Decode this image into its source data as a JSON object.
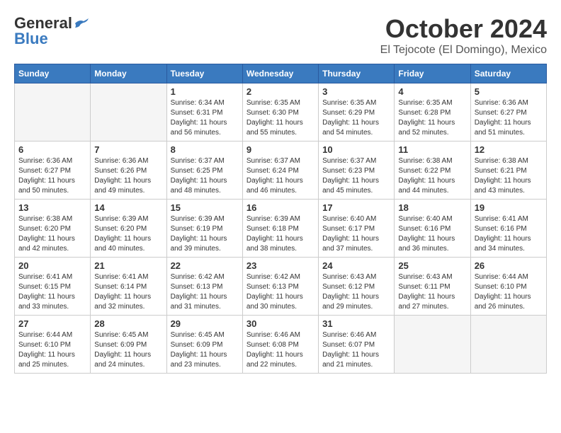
{
  "header": {
    "logo_line1": "General",
    "logo_line2": "Blue",
    "month": "October 2024",
    "location": "El Tejocote (El Domingo), Mexico"
  },
  "days_of_week": [
    "Sunday",
    "Monday",
    "Tuesday",
    "Wednesday",
    "Thursday",
    "Friday",
    "Saturday"
  ],
  "weeks": [
    [
      {
        "day": "",
        "info": ""
      },
      {
        "day": "",
        "info": ""
      },
      {
        "day": "1",
        "info": "Sunrise: 6:34 AM\nSunset: 6:31 PM\nDaylight: 11 hours and 56 minutes."
      },
      {
        "day": "2",
        "info": "Sunrise: 6:35 AM\nSunset: 6:30 PM\nDaylight: 11 hours and 55 minutes."
      },
      {
        "day": "3",
        "info": "Sunrise: 6:35 AM\nSunset: 6:29 PM\nDaylight: 11 hours and 54 minutes."
      },
      {
        "day": "4",
        "info": "Sunrise: 6:35 AM\nSunset: 6:28 PM\nDaylight: 11 hours and 52 minutes."
      },
      {
        "day": "5",
        "info": "Sunrise: 6:36 AM\nSunset: 6:27 PM\nDaylight: 11 hours and 51 minutes."
      }
    ],
    [
      {
        "day": "6",
        "info": "Sunrise: 6:36 AM\nSunset: 6:27 PM\nDaylight: 11 hours and 50 minutes."
      },
      {
        "day": "7",
        "info": "Sunrise: 6:36 AM\nSunset: 6:26 PM\nDaylight: 11 hours and 49 minutes."
      },
      {
        "day": "8",
        "info": "Sunrise: 6:37 AM\nSunset: 6:25 PM\nDaylight: 11 hours and 48 minutes."
      },
      {
        "day": "9",
        "info": "Sunrise: 6:37 AM\nSunset: 6:24 PM\nDaylight: 11 hours and 46 minutes."
      },
      {
        "day": "10",
        "info": "Sunrise: 6:37 AM\nSunset: 6:23 PM\nDaylight: 11 hours and 45 minutes."
      },
      {
        "day": "11",
        "info": "Sunrise: 6:38 AM\nSunset: 6:22 PM\nDaylight: 11 hours and 44 minutes."
      },
      {
        "day": "12",
        "info": "Sunrise: 6:38 AM\nSunset: 6:21 PM\nDaylight: 11 hours and 43 minutes."
      }
    ],
    [
      {
        "day": "13",
        "info": "Sunrise: 6:38 AM\nSunset: 6:20 PM\nDaylight: 11 hours and 42 minutes."
      },
      {
        "day": "14",
        "info": "Sunrise: 6:39 AM\nSunset: 6:20 PM\nDaylight: 11 hours and 40 minutes."
      },
      {
        "day": "15",
        "info": "Sunrise: 6:39 AM\nSunset: 6:19 PM\nDaylight: 11 hours and 39 minutes."
      },
      {
        "day": "16",
        "info": "Sunrise: 6:39 AM\nSunset: 6:18 PM\nDaylight: 11 hours and 38 minutes."
      },
      {
        "day": "17",
        "info": "Sunrise: 6:40 AM\nSunset: 6:17 PM\nDaylight: 11 hours and 37 minutes."
      },
      {
        "day": "18",
        "info": "Sunrise: 6:40 AM\nSunset: 6:16 PM\nDaylight: 11 hours and 36 minutes."
      },
      {
        "day": "19",
        "info": "Sunrise: 6:41 AM\nSunset: 6:16 PM\nDaylight: 11 hours and 34 minutes."
      }
    ],
    [
      {
        "day": "20",
        "info": "Sunrise: 6:41 AM\nSunset: 6:15 PM\nDaylight: 11 hours and 33 minutes."
      },
      {
        "day": "21",
        "info": "Sunrise: 6:41 AM\nSunset: 6:14 PM\nDaylight: 11 hours and 32 minutes."
      },
      {
        "day": "22",
        "info": "Sunrise: 6:42 AM\nSunset: 6:13 PM\nDaylight: 11 hours and 31 minutes."
      },
      {
        "day": "23",
        "info": "Sunrise: 6:42 AM\nSunset: 6:13 PM\nDaylight: 11 hours and 30 minutes."
      },
      {
        "day": "24",
        "info": "Sunrise: 6:43 AM\nSunset: 6:12 PM\nDaylight: 11 hours and 29 minutes."
      },
      {
        "day": "25",
        "info": "Sunrise: 6:43 AM\nSunset: 6:11 PM\nDaylight: 11 hours and 27 minutes."
      },
      {
        "day": "26",
        "info": "Sunrise: 6:44 AM\nSunset: 6:10 PM\nDaylight: 11 hours and 26 minutes."
      }
    ],
    [
      {
        "day": "27",
        "info": "Sunrise: 6:44 AM\nSunset: 6:10 PM\nDaylight: 11 hours and 25 minutes."
      },
      {
        "day": "28",
        "info": "Sunrise: 6:45 AM\nSunset: 6:09 PM\nDaylight: 11 hours and 24 minutes."
      },
      {
        "day": "29",
        "info": "Sunrise: 6:45 AM\nSunset: 6:09 PM\nDaylight: 11 hours and 23 minutes."
      },
      {
        "day": "30",
        "info": "Sunrise: 6:46 AM\nSunset: 6:08 PM\nDaylight: 11 hours and 22 minutes."
      },
      {
        "day": "31",
        "info": "Sunrise: 6:46 AM\nSunset: 6:07 PM\nDaylight: 11 hours and 21 minutes."
      },
      {
        "day": "",
        "info": ""
      },
      {
        "day": "",
        "info": ""
      }
    ]
  ]
}
